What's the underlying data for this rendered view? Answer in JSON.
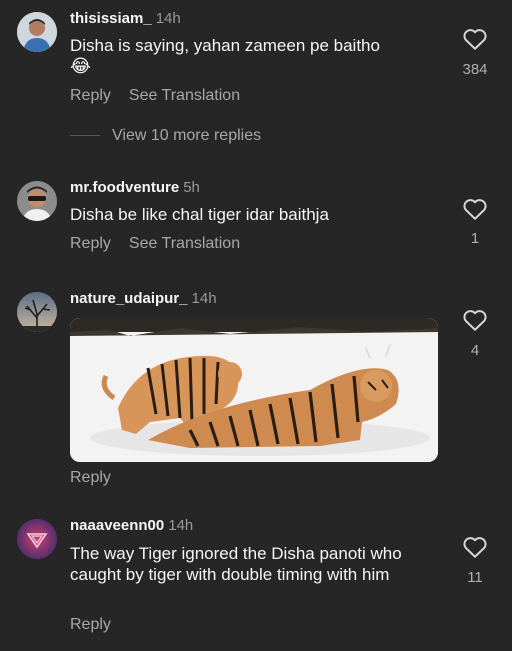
{
  "comments": [
    {
      "username": "thisissiam_",
      "time": "14h",
      "text": "Disha is saying, yahan zameen pe baitho",
      "emoji": "😂",
      "likes": "384",
      "reply_label": "Reply",
      "translate_label": "See Translation",
      "more_replies": "View 10 more replies"
    },
    {
      "username": "mr.foodventure",
      "time": "5h",
      "text": "Disha be like chal tiger idar baithja",
      "likes": "1",
      "reply_label": "Reply",
      "translate_label": "See Translation"
    },
    {
      "username": "nature_udaipur_",
      "time": "14h",
      "likes": "4",
      "reply_label": "Reply"
    },
    {
      "username": "naaaveenn00",
      "time": "14h",
      "text": "The way Tiger ignored the Disha panoti who caught by tiger with double timing with him",
      "likes": "11",
      "reply_label": "Reply"
    }
  ],
  "colors": {
    "background": "#262626",
    "secondary_text": "#a8a8a8"
  }
}
